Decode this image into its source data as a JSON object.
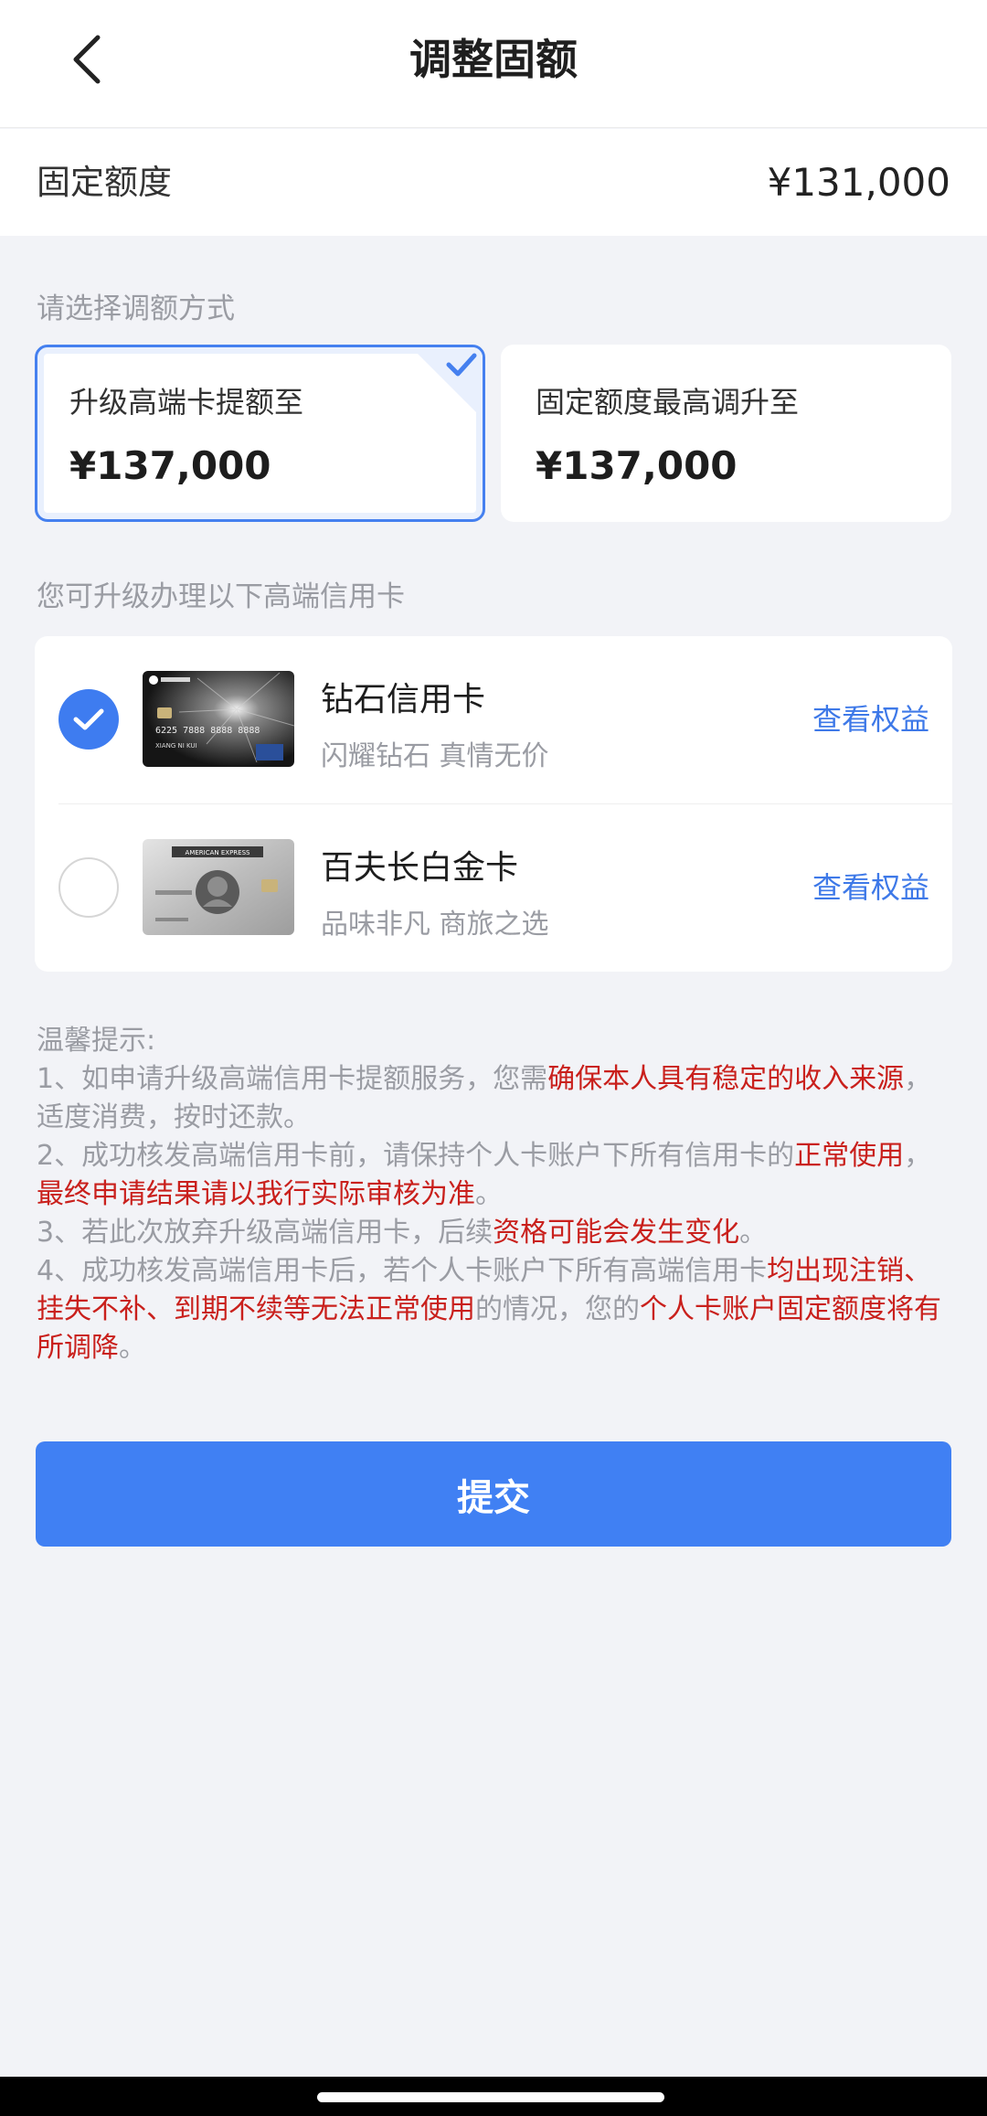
{
  "header": {
    "title": "调整固额"
  },
  "fixed_limit": {
    "label": "固定额度",
    "value": "¥131,000"
  },
  "adjust_section": {
    "label": "请选择调额方式",
    "options": [
      {
        "label": "升级高端卡提额至",
        "amount": "¥137,000",
        "selected": true
      },
      {
        "label": "固定额度最高调升至",
        "amount": "¥137,000",
        "selected": false
      }
    ]
  },
  "cards_section": {
    "label": "您可升级办理以下高端信用卡",
    "cards": [
      {
        "name": "钻石信用卡",
        "slogan": "闪耀钻石 真情无价",
        "link": "查看权益",
        "checked": true,
        "image_text": {
          "number": "6225 7888 8888 8888",
          "holder": "XIANG NI KUI"
        }
      },
      {
        "name": "百夫长白金卡",
        "slogan": "品味非凡 商旅之选",
        "link": "查看权益",
        "checked": false,
        "image_text": {
          "brand": "AMERICAN EXPRESS"
        }
      }
    ]
  },
  "notes": {
    "title": "温馨提示:",
    "items": [
      [
        {
          "text": "1、如申请升级高端信用卡提额服务，您需",
          "hl": false
        },
        {
          "text": "确保本人具有稳定的收入来源",
          "hl": true
        },
        {
          "text": "，适度消费，按时还款。",
          "hl": false
        }
      ],
      [
        {
          "text": "2、成功核发高端信用卡前，请保持个人卡账户下所有信用卡的",
          "hl": false
        },
        {
          "text": "正常使用",
          "hl": true
        },
        {
          "text": "，",
          "hl": false
        },
        {
          "text": "最终申请结果请以我行实际审核为准",
          "hl": true
        },
        {
          "text": "。",
          "hl": false
        }
      ],
      [
        {
          "text": "3、若此次放弃升级高端信用卡，后续",
          "hl": false
        },
        {
          "text": "资格可能会发生变化",
          "hl": true
        },
        {
          "text": "。",
          "hl": false
        }
      ],
      [
        {
          "text": "4、成功核发高端信用卡后，若个人卡账户下所有高端信用卡",
          "hl": false
        },
        {
          "text": "均出现注销、挂失不补、到期不续等无法正常使用",
          "hl": true
        },
        {
          "text": "的情况，您的",
          "hl": false
        },
        {
          "text": "个人卡账户固定额度将有所调降",
          "hl": true
        },
        {
          "text": "。",
          "hl": false
        }
      ]
    ]
  },
  "submit": {
    "label": "提交"
  },
  "colors": {
    "accent": "#4080f3",
    "link": "#3e79e8",
    "warning": "#c9201c",
    "background": "#f2f3f7"
  },
  "icons": {
    "back": "chevron-left-icon",
    "selected_corner": "check-icon",
    "radio_checked": "check-circle-icon"
  }
}
